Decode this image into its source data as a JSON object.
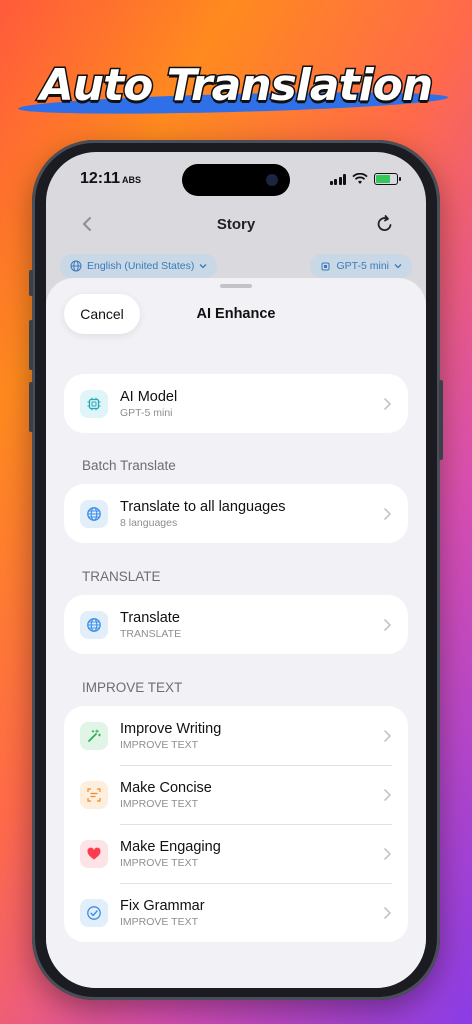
{
  "banner": {
    "title": "Auto Translation"
  },
  "status": {
    "time": "12:11",
    "time_badge": "ABS"
  },
  "nav": {
    "title": "Story"
  },
  "chips": {
    "language": "English (United States)",
    "model": "GPT-5 mini"
  },
  "sheet": {
    "cancel_label": "Cancel",
    "title": "AI Enhance",
    "model_row": {
      "title": "AI Model",
      "subtitle": "GPT-5 mini"
    },
    "batch": {
      "label": "Batch Translate",
      "row": {
        "title": "Translate to all languages",
        "subtitle": "8 languages"
      }
    },
    "translate": {
      "label": "TRANSLATE",
      "row": {
        "title": "Translate",
        "subtitle": "TRANSLATE"
      }
    },
    "improve": {
      "label": "IMPROVE TEXT",
      "rows": [
        {
          "title": "Improve Writing",
          "subtitle": "IMPROVE TEXT"
        },
        {
          "title": "Make Concise",
          "subtitle": "IMPROVE TEXT"
        },
        {
          "title": "Make Engaging",
          "subtitle": "IMPROVE TEXT"
        },
        {
          "title": "Fix Grammar",
          "subtitle": "IMPROVE TEXT"
        }
      ]
    }
  },
  "colors": {
    "accent_blue": "#3a8ee6",
    "chip_text": "#3a7ab8",
    "battery_green": "#34c759",
    "heart_red": "#ff3b4e"
  }
}
